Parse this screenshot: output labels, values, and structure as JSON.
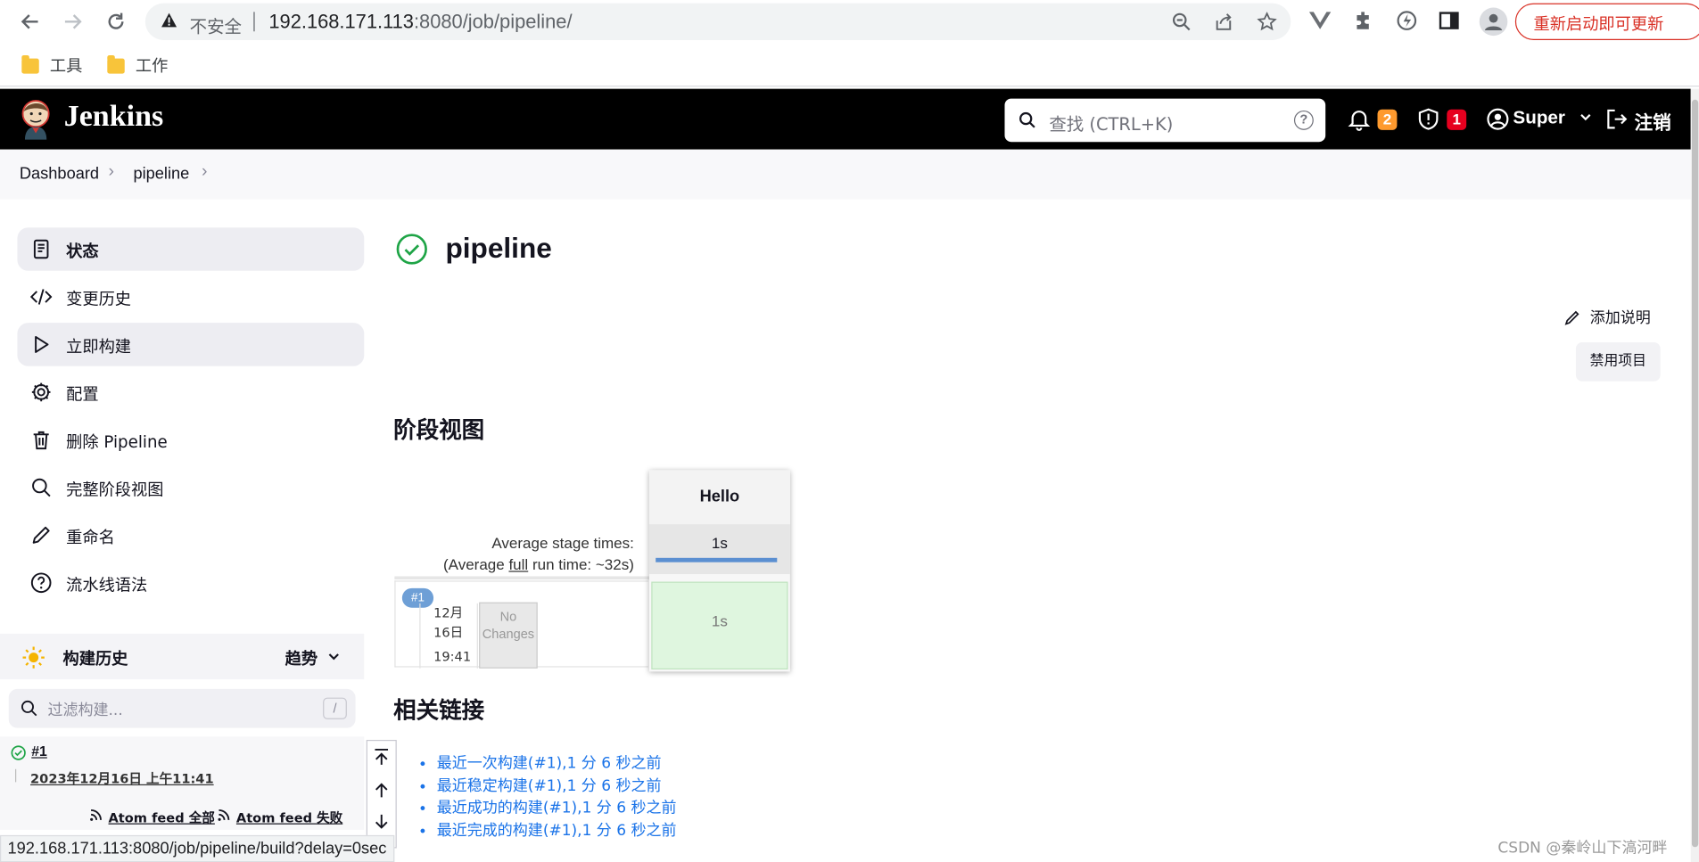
{
  "browser": {
    "warning_label": "不安全",
    "url_host": "192.168.171.113",
    "url_rest": ":8080/job/pipeline/",
    "update_button": "重新启动即可更新",
    "bookmarks": [
      "工具",
      "工作"
    ]
  },
  "header": {
    "title": "Jenkins",
    "search_placeholder": "查找 (CTRL+K)",
    "notifications_count": "2",
    "security_count": "1",
    "user_name": "Super",
    "logout_label": "注销"
  },
  "breadcrumb": [
    "Dashboard",
    "pipeline"
  ],
  "sidebar": {
    "items": [
      {
        "label": "状态",
        "icon": "document-icon"
      },
      {
        "label": "变更历史",
        "icon": "code-icon"
      },
      {
        "label": "立即构建",
        "icon": "play-icon"
      },
      {
        "label": "配置",
        "icon": "gear-icon"
      },
      {
        "label": "删除 Pipeline",
        "icon": "trash-icon"
      },
      {
        "label": "完整阶段视图",
        "icon": "search-icon"
      },
      {
        "label": "重命名",
        "icon": "pencil-icon"
      },
      {
        "label": "流水线语法",
        "icon": "help-icon"
      }
    ],
    "build_history": {
      "title": "构建历史",
      "trend_label": "趋势",
      "filter_placeholder": "过滤构建...",
      "filter_shortcut": "/",
      "builds": [
        {
          "number": "#1",
          "date": "2023年12月16日 上午11:41"
        }
      ],
      "feed_all": "Atom feed 全部",
      "feed_failed": "Atom feed 失败"
    }
  },
  "main": {
    "title": "pipeline",
    "add_description": "添加说明",
    "disable_project": "禁用项目",
    "stage_view_heading": "阶段视图",
    "avg_stage_label": "Average stage times:",
    "avg_full_prefix": "(Average ",
    "avg_full_link": "full",
    "avg_full_suffix": " run time: ~32s)",
    "stage_name": "Hello",
    "stage_avg_time": "1s",
    "run": {
      "badge": "#1",
      "date_month": "12月",
      "date_day": "16日",
      "time": "19:41",
      "no_changes": "No Changes",
      "stage_time": "1s"
    },
    "related_heading": "相关链接",
    "related_links": [
      "最近一次构建(#1),1 分 6 秒之前",
      "最近稳定构建(#1),1 分 6 秒之前",
      "最近成功的构建(#1),1 分 6 秒之前",
      "最近完成的构建(#1),1 分 6 秒之前"
    ]
  },
  "status_bar": "192.168.171.113:8080/job/pipeline/build?delay=0sec",
  "watermark": "CSDN @秦岭山下滈河畔",
  "colors": {
    "header_bg": "#000000",
    "success_green": "#1ea446",
    "notify_badge": "#fe9a2e",
    "security_badge": "#e6001f",
    "link_blue": "#1a73e8"
  }
}
